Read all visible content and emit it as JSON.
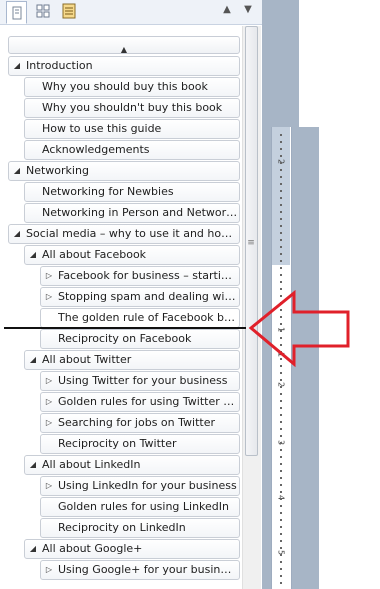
{
  "nav": {
    "tabs": [
      {
        "name": "browse-headings-tab",
        "icon": "document-icon",
        "active": true
      },
      {
        "name": "browse-pages-tab",
        "icon": "grid-icon",
        "active": false
      },
      {
        "name": "browse-results-tab",
        "icon": "list-icon",
        "active": false
      }
    ],
    "scroll_up_glyph": "▲",
    "items": [
      {
        "label": "Introduction",
        "level": 1,
        "toggle": "◢"
      },
      {
        "label": "Why you should buy this book",
        "level": 2,
        "toggle": ""
      },
      {
        "label": "Why you shouldn't buy this book",
        "level": 2,
        "toggle": ""
      },
      {
        "label": "How to use this guide",
        "level": 2,
        "toggle": ""
      },
      {
        "label": "Acknowledgements",
        "level": 2,
        "toggle": ""
      },
      {
        "label": "Networking",
        "level": 1,
        "toggle": "◢"
      },
      {
        "label": "Networking for Newbies",
        "level": 2,
        "toggle": ""
      },
      {
        "label": "Networking in Person and Networki...",
        "level": 2,
        "toggle": ""
      },
      {
        "label": "Social media – why to use it and how it...",
        "level": 1,
        "toggle": "◢"
      },
      {
        "label": "All about Facebook",
        "level": 2,
        "toggle": "◢"
      },
      {
        "label": "Facebook for business – starting...",
        "level": 3,
        "toggle": "▷"
      },
      {
        "label": "Stopping spam and dealing with...",
        "level": 3,
        "toggle": "▷"
      },
      {
        "label": "The golden rule of Facebook bus...",
        "level": 3,
        "toggle": "",
        "selected": true
      },
      {
        "label": "Reciprocity on Facebook",
        "level": 3,
        "toggle": ""
      },
      {
        "label": "All about Twitter",
        "level": 2,
        "toggle": "◢"
      },
      {
        "label": "Using Twitter for your business",
        "level": 3,
        "toggle": "▷"
      },
      {
        "label": "Golden rules for using Twitter ef...",
        "level": 3,
        "toggle": "▷"
      },
      {
        "label": "Searching for jobs on Twitter",
        "level": 3,
        "toggle": "▷"
      },
      {
        "label": "Reciprocity on Twitter",
        "level": 3,
        "toggle": ""
      },
      {
        "label": "All about LinkedIn",
        "level": 2,
        "toggle": "◢"
      },
      {
        "label": "Using LinkedIn for your business",
        "level": 3,
        "toggle": "▷"
      },
      {
        "label": "Golden rules for using LinkedIn",
        "level": 3,
        "toggle": ""
      },
      {
        "label": "Reciprocity on LinkedIn",
        "level": 3,
        "toggle": ""
      },
      {
        "label": "All about Google+",
        "level": 2,
        "toggle": "◢"
      },
      {
        "label": "Using Google+ for your business",
        "level": 3,
        "toggle": "▷"
      }
    ],
    "scrollbar_grip": "≡"
  },
  "ruler": {
    "numbers": [
      "2",
      "1",
      "1",
      "2",
      "3",
      "4",
      "5"
    ]
  },
  "annotation": {
    "arrow_color": "#e0202a"
  }
}
